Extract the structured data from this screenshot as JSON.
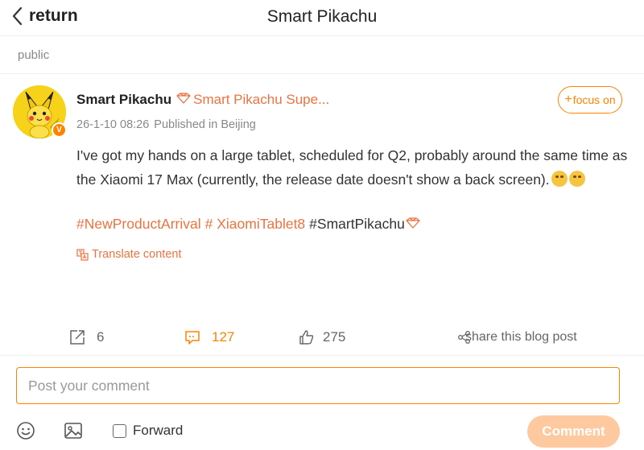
{
  "header": {
    "back_label": "return",
    "title": "Smart Pikachu"
  },
  "post": {
    "visibility": "public",
    "author": {
      "name": "Smart Pikachu",
      "title": "Smart Pikachu Supe...",
      "avatar": "pikachu-avatar",
      "verified_badge": "V"
    },
    "follow_label": "focus on",
    "timestamp": "26-1-10 08:26",
    "location": "Published in Beijing",
    "text": "I've got my hands on a large tablet, scheduled for Q2, probably around the same time as the Xiaomi 17 Max (currently, the release date doesn't show a back screen).",
    "tags": [
      "#NewProductArrival",
      "# XiaomiTablet8"
    ],
    "plain_tag": "#SmartPikachu",
    "translate_label": "Translate content"
  },
  "actions": {
    "reposts": "6",
    "comments": "127",
    "likes": "275",
    "share_label": "share this blog post"
  },
  "composer": {
    "placeholder": "Post your comment",
    "forward_label": "Forward",
    "submit_label": "Comment"
  },
  "colors": {
    "accent": "#ff8200",
    "link": "#eb7340",
    "submit_disabled": "#ffc9a0",
    "avatar_bg": "#f7d21a"
  }
}
